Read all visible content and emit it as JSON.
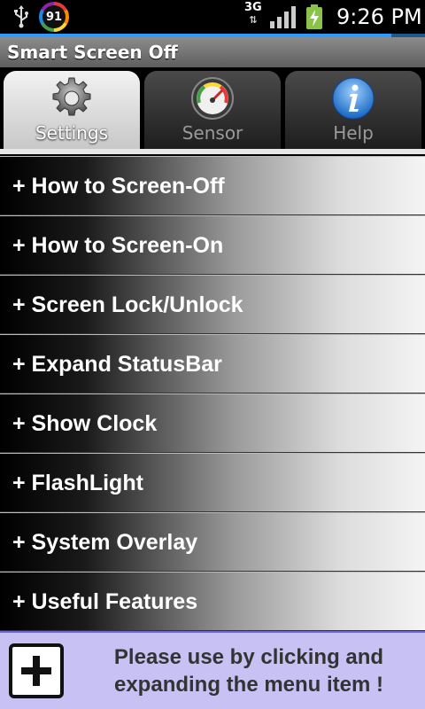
{
  "status_bar": {
    "battery_level": "91",
    "network": "3G",
    "time": "9:26 PM",
    "icons": [
      "usb-icon",
      "battery-badge-icon",
      "network-arrows-icon",
      "signal-icon",
      "charging-battery-icon"
    ]
  },
  "app": {
    "title": "Smart Screen Off"
  },
  "tabs": [
    {
      "label": "Settings",
      "icon": "gear-icon",
      "active": true
    },
    {
      "label": "Sensor",
      "icon": "speedometer-icon",
      "active": false
    },
    {
      "label": "Help",
      "icon": "info-icon",
      "active": false
    }
  ],
  "menu": {
    "items": [
      "+ How to Screen-Off",
      "+ How to Screen-On",
      "+ Screen Lock/Unlock",
      "+ Expand StatusBar",
      "+ Show Clock",
      "+ FlashLight",
      "+ System Overlay",
      "+ Useful Features"
    ]
  },
  "banner": {
    "line1": "Please use by clicking and",
    "line2": "expanding the menu item !",
    "icon": "plus-box-icon"
  },
  "colors": {
    "banner_bg": "#c7c1f4",
    "banner_border": "#6f66d6",
    "progress": "#2f9bff"
  }
}
